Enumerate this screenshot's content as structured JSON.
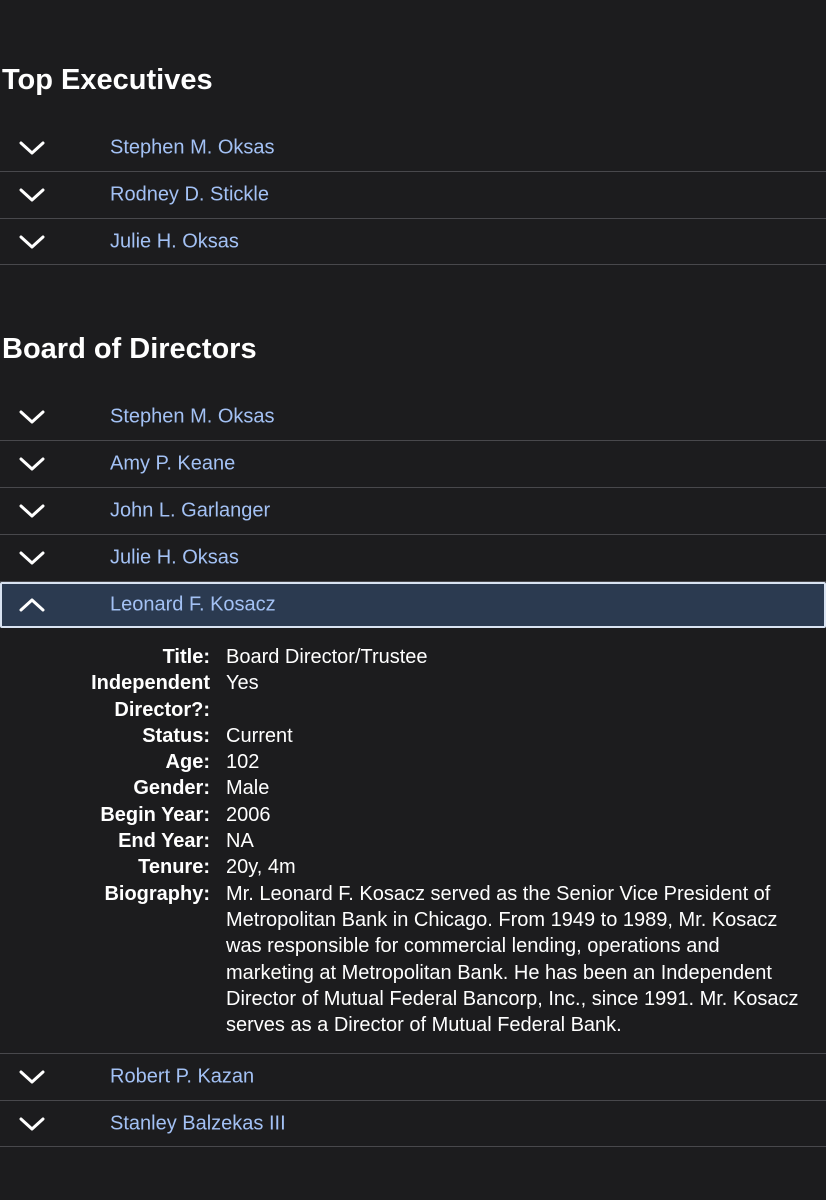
{
  "top_executives": {
    "title": "Top Executives",
    "items": [
      {
        "name": "Stephen M. Oksas"
      },
      {
        "name": "Rodney D. Stickle"
      },
      {
        "name": "Julie H. Oksas"
      }
    ]
  },
  "board": {
    "title": "Board of Directors",
    "items_before": [
      {
        "name": "Stephen M. Oksas"
      },
      {
        "name": "Amy P. Keane"
      },
      {
        "name": "John L. Garlanger"
      },
      {
        "name": "Julie H. Oksas"
      }
    ],
    "expanded": {
      "name": "Leonard F. Kosacz",
      "fields": [
        {
          "label": "Title:",
          "value": "Board Director/Trustee"
        },
        {
          "label": "Independent Director?:",
          "value": "Yes"
        },
        {
          "label": "Status:",
          "value": "Current"
        },
        {
          "label": "Age:",
          "value": "102"
        },
        {
          "label": "Gender:",
          "value": "Male"
        },
        {
          "label": "Begin Year:",
          "value": "2006"
        },
        {
          "label": "End Year:",
          "value": "NA"
        },
        {
          "label": "Tenure:",
          "value": "20y, 4m"
        },
        {
          "label": "Biography:",
          "value": "Mr. Leonard F. Kosacz served as the Senior Vice President of Metropolitan Bank in Chicago. From 1949 to 1989, Mr. Kosacz was responsible for commercial lending, operations and marketing at Metropolitan Bank. He has been an Independent Director of Mutual Federal Bancorp, Inc., since 1991. Mr. Kosacz serves as a Director of Mutual Federal Bank."
        }
      ]
    },
    "items_after": [
      {
        "name": "Robert P. Kazan"
      },
      {
        "name": "Stanley Balzekas III"
      }
    ]
  },
  "icons": {
    "collapsed": "chevron-down-icon",
    "expanded": "chevron-up-icon"
  },
  "colors": {
    "background": "#1c1c1e",
    "link": "#a3c1f4",
    "expanded_row_bg": "#2b3a50",
    "divider": "#48484c"
  }
}
